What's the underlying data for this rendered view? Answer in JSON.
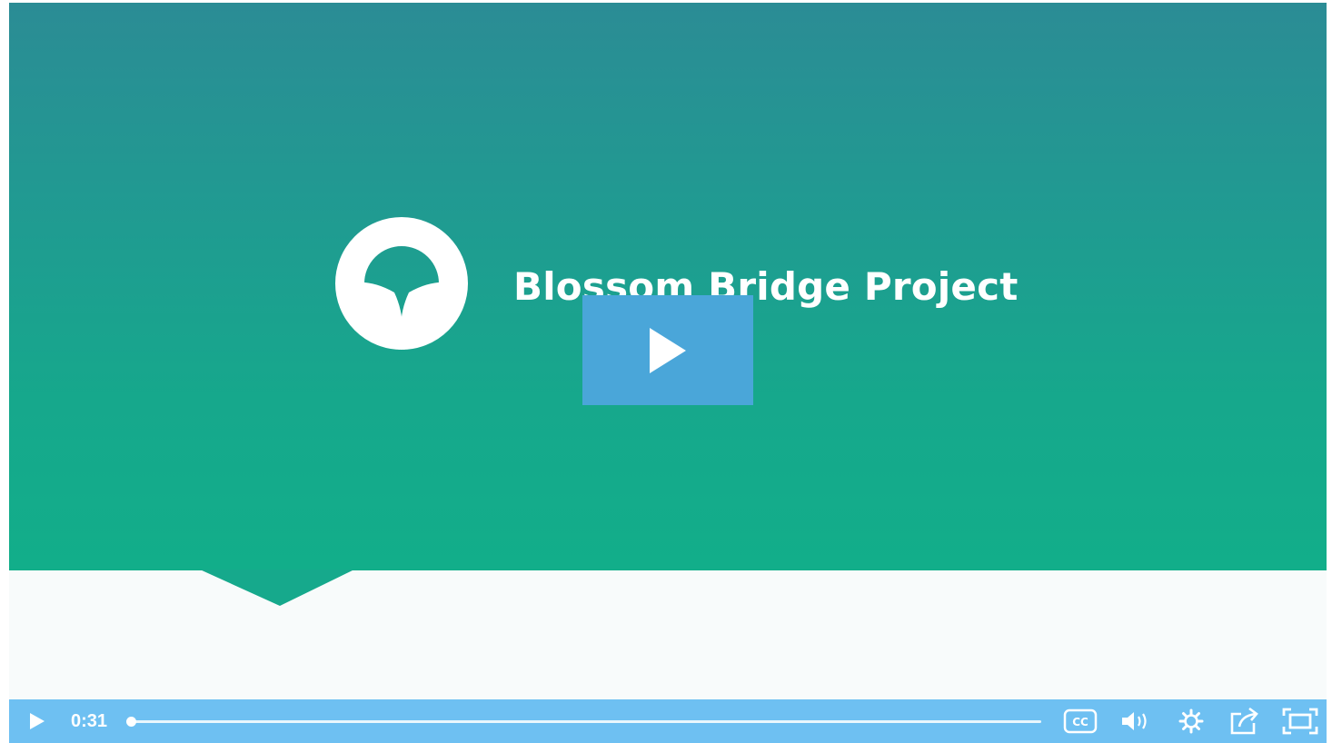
{
  "video": {
    "title": "Blossom Bridge Project",
    "current_time": "0:31",
    "progress_fraction": 0.0
  },
  "icons": {
    "logo": "blossom-logo-icon",
    "big_play": "play-icon",
    "play": "play-icon",
    "captions": "closed-captions-icon",
    "volume": "volume-icon",
    "settings": "gear-icon",
    "share": "share-icon",
    "fullscreen": "fullscreen-icon"
  },
  "colors": {
    "control_bar": "#6ec0f2",
    "big_play_button": "#4aa6d9",
    "hero_gradient_top": "#2b8c95",
    "hero_gradient_bottom": "#12ae8a"
  }
}
